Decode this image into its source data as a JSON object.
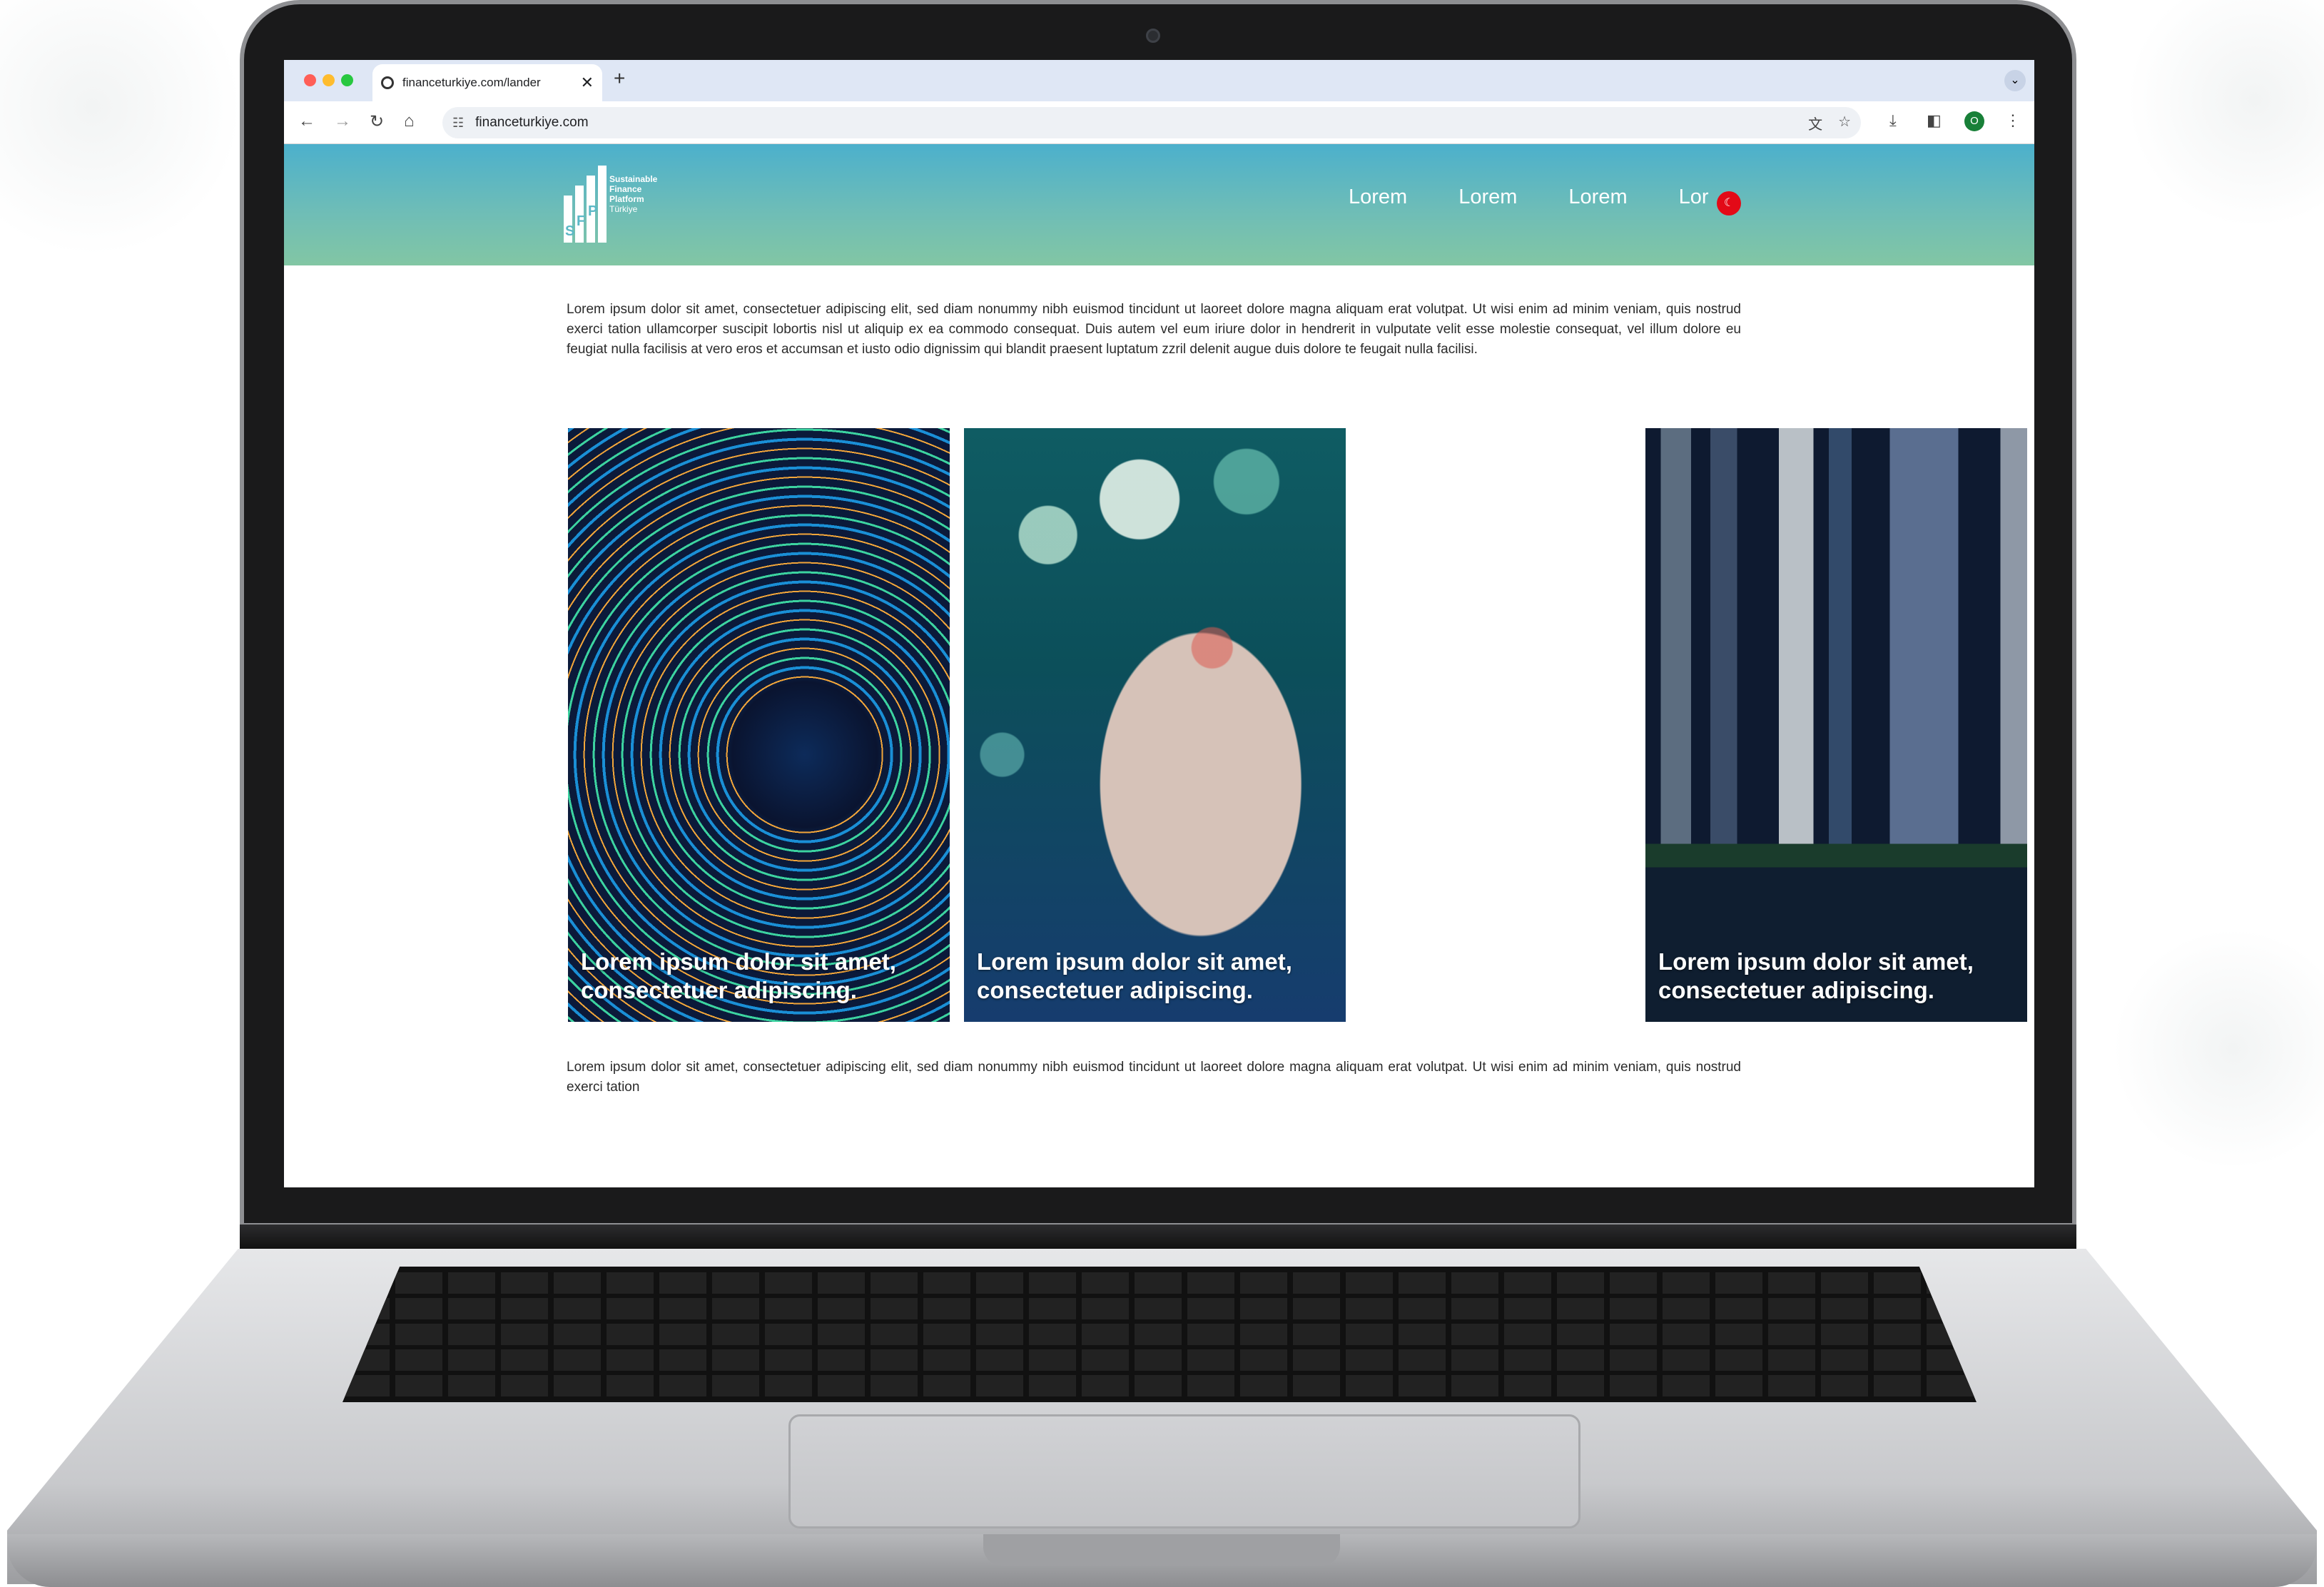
{
  "browser": {
    "tab_title": "financeturkiye.com/lander",
    "tab_close": "✕",
    "new_tab": "+",
    "tab_menu": "⌄",
    "url": "financeturkiye.com",
    "back_icon": "←",
    "forward_icon": "→",
    "reload_icon": "↻",
    "home_icon": "⌂",
    "tune_icon": "☷",
    "translate_icon": "文",
    "bookmark_icon": "☆",
    "download_icon": "⤓",
    "sidepanel_icon": "◧",
    "profile_initial": "O",
    "menu_icon": "⋮"
  },
  "site": {
    "logo": {
      "letters": [
        "S",
        "F",
        "P"
      ],
      "lines": [
        "Sustainable",
        "Finance",
        "Platform",
        "Türkiye"
      ]
    },
    "nav": [
      "Lorem",
      "Lorem",
      "Lorem",
      "Lor"
    ],
    "flag_icon": "☾",
    "intro": "Lorem ipsum dolor sit amet, consectetuer adipiscing elit, sed diam nonummy nibh euismod tincidunt ut laoreet dolore magna aliquam erat volutpat. Ut wisi enim ad minim veniam, quis nostrud exerci tation ullamcorper suscipit lobortis nisl ut aliquip ex ea commodo consequat. Duis autem vel eum iriure dolor in hendrerit in vulputate velit esse molestie consequat, vel illum dolore eu feugiat nulla facilisis at vero eros et accumsan et iusto odio dignissim qui blandit praesent luptatum zzril delenit augue duis dolore te feugait nulla facilisi.",
    "cards": [
      {
        "caption": "Lorem ipsum dolor sit amet, consectetuer adipiscing."
      },
      {
        "caption": "Lorem ipsum dolor sit amet, consectetuer adipiscing."
      },
      {
        "caption": "Lorem ipsum dolor sit amet, consectetuer adipiscing."
      }
    ],
    "footer_text": "Lorem ipsum dolor sit amet, consectetuer adipiscing elit, sed diam nonummy nibh euismod tincidunt ut laoreet dolore magna aliquam erat volutpat. Ut wisi enim ad minim veniam, quis nostrud exerci tation"
  },
  "colors": {
    "header_top": "#4cb0cc",
    "header_bottom": "#82c6a4",
    "flag": "#e30a17"
  }
}
